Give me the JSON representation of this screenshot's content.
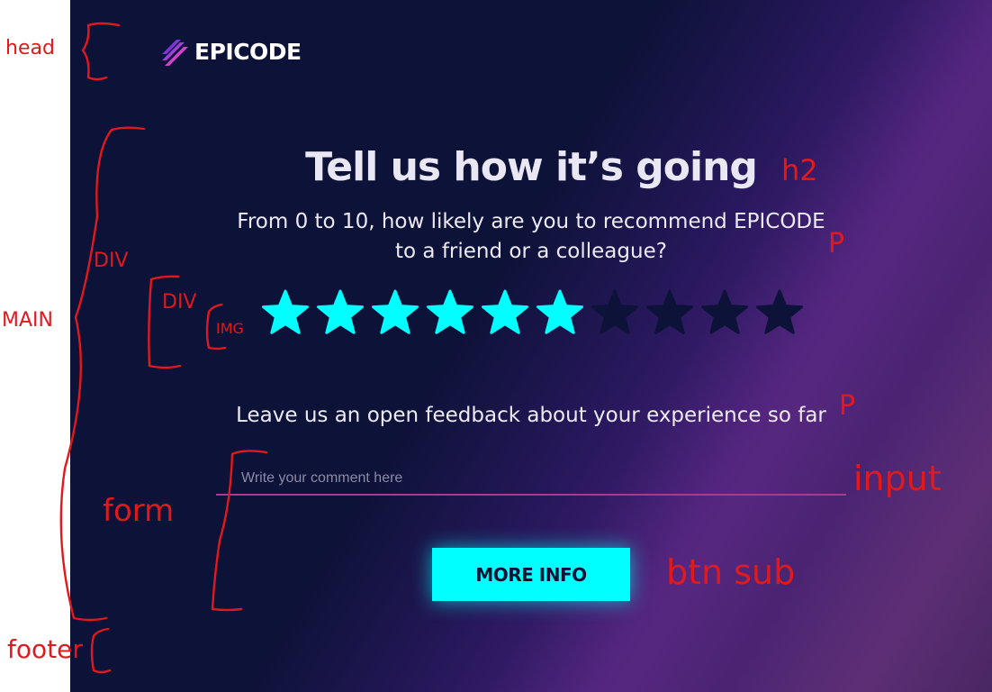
{
  "header": {
    "brand": "EPICODE"
  },
  "main": {
    "title": "Tell us how it’s going",
    "question_line1": "From 0 to 10, how likely are you to recommend EPICODE",
    "question_line2": "to a friend or a colleague?",
    "rating": {
      "value": 6,
      "max": 10,
      "active_color": "#00ffff",
      "inactive_color": "#0d1238"
    },
    "feedback_prompt": "Leave us an open feedback about your experience so far"
  },
  "form": {
    "comment_placeholder": "Write your comment here",
    "comment_value": "",
    "submit_label": "MORE INFO"
  },
  "annotations": {
    "head": "head",
    "main": "MAIN",
    "div_outer": "DIV",
    "div_inner": "DIV",
    "img": "IMG",
    "form": "form",
    "footer": "footer",
    "h2": "h2",
    "p1": "P",
    "p2": "P",
    "input": "input",
    "btn": "btn sub"
  },
  "colors": {
    "background": "#0d1238",
    "accent": "#00ffff",
    "underline": "#b2358f",
    "annotation": "#e0191c"
  }
}
